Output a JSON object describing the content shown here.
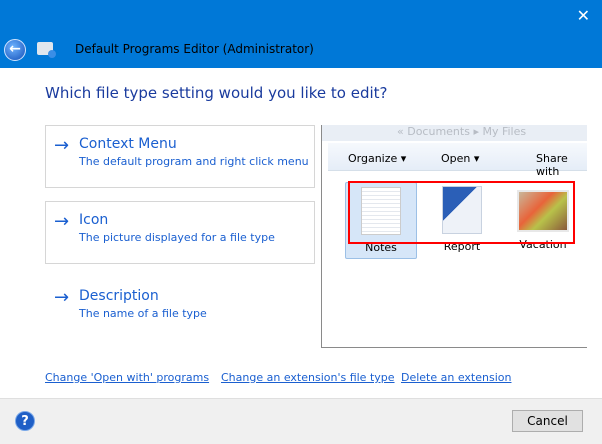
{
  "window": {
    "title": "Default Programs Editor (Administrator)",
    "close": "✕",
    "back": "←"
  },
  "heading": "Which file type setting would you like to edit?",
  "options": [
    {
      "title": "Context Menu",
      "desc": "The default program and right click menu"
    },
    {
      "title": "Icon",
      "desc": "The picture displayed for a file type"
    },
    {
      "title": "Description",
      "desc": "The name of a file type"
    }
  ],
  "arrow": "→",
  "preview": {
    "address": "«  Documents  ▸  My Files",
    "toolbar": [
      "Organize ▾",
      "Open  ▾",
      "Share with"
    ],
    "files": [
      "Notes",
      "Report",
      "Vacation"
    ]
  },
  "links": [
    "Change 'Open with' programs",
    "Change an extension's file type",
    "Delete an extension"
  ],
  "footer": {
    "help": "?",
    "cancel": "Cancel"
  }
}
